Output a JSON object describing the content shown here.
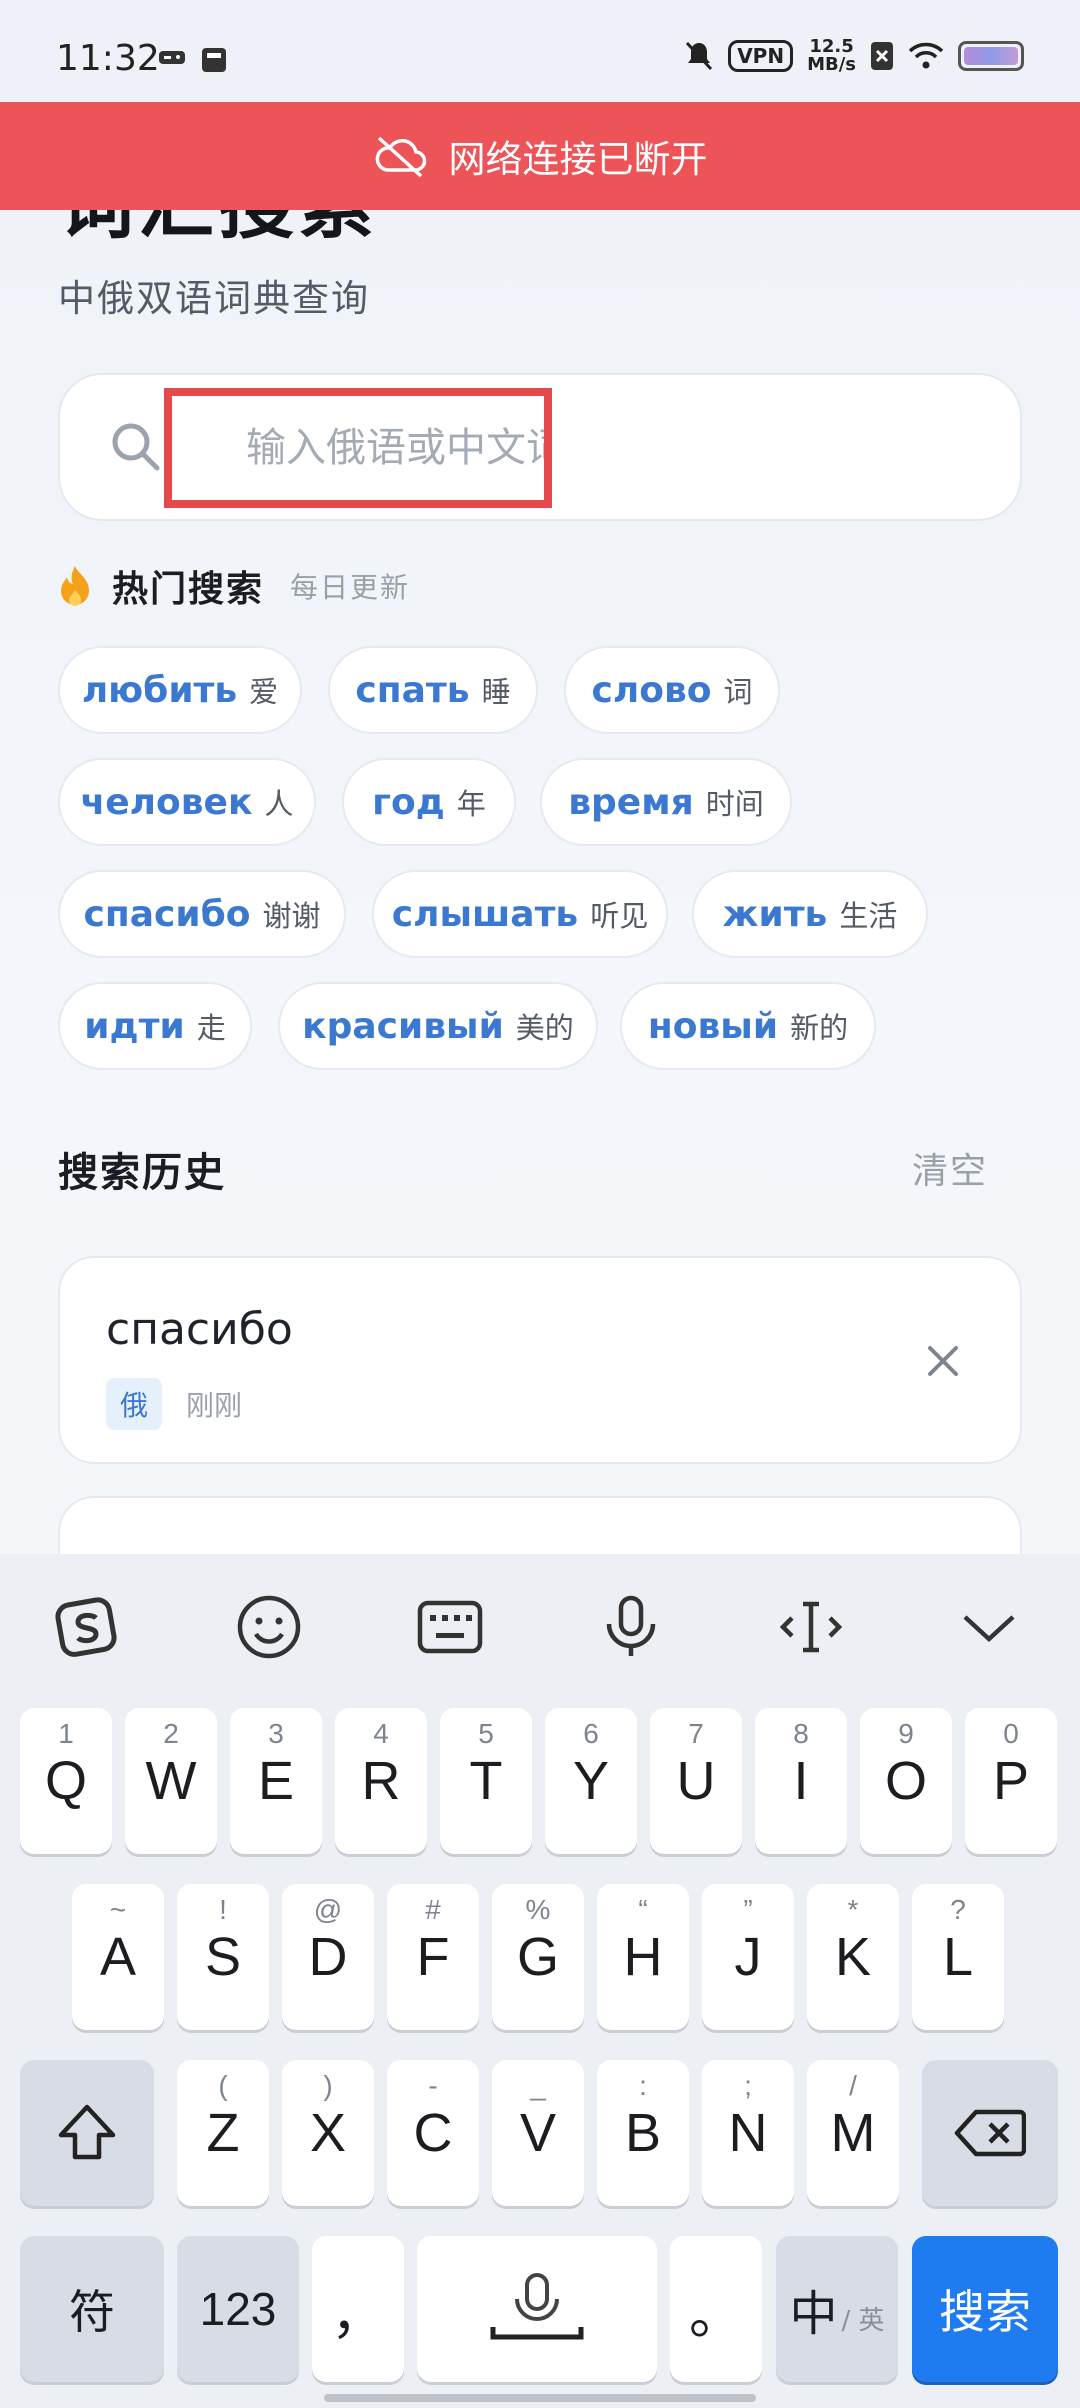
{
  "status_bar": {
    "time": "11:32",
    "vpn": "VPN",
    "speed_value": "12.5",
    "speed_unit": "MB/s"
  },
  "offline_banner": {
    "text": "网络连接已断开",
    "color": "#ec5457"
  },
  "header": {
    "title": "词汇搜索",
    "subtitle": "中俄双语词典查询"
  },
  "search": {
    "placeholder": "输入俄语或中文词汇",
    "value": ""
  },
  "hot": {
    "title": "热门搜索",
    "subtitle": "每日更新",
    "chips": [
      {
        "ru": "любить",
        "zh": "爱"
      },
      {
        "ru": "спать",
        "zh": "睡"
      },
      {
        "ru": "слово",
        "zh": "词"
      },
      {
        "ru": "человек",
        "zh": "人"
      },
      {
        "ru": "год",
        "zh": "年"
      },
      {
        "ru": "время",
        "zh": "时间"
      },
      {
        "ru": "спасибо",
        "zh": "谢谢"
      },
      {
        "ru": "слышать",
        "zh": "听见"
      },
      {
        "ru": "жить",
        "zh": "生活"
      },
      {
        "ru": "идти",
        "zh": "走"
      },
      {
        "ru": "красивый",
        "zh": "美的"
      },
      {
        "ru": "новый",
        "zh": "新的"
      }
    ]
  },
  "history": {
    "title": "搜索历史",
    "clear_label": "清空",
    "items": [
      {
        "word": "спасибо",
        "lang": "俄",
        "time": "刚刚"
      }
    ]
  },
  "keyboard": {
    "row1": [
      {
        "main": "Q",
        "sub": "1"
      },
      {
        "main": "W",
        "sub": "2"
      },
      {
        "main": "E",
        "sub": "3"
      },
      {
        "main": "R",
        "sub": "4"
      },
      {
        "main": "T",
        "sub": "5"
      },
      {
        "main": "Y",
        "sub": "6"
      },
      {
        "main": "U",
        "sub": "7"
      },
      {
        "main": "I",
        "sub": "8"
      },
      {
        "main": "O",
        "sub": "9"
      },
      {
        "main": "P",
        "sub": "0"
      }
    ],
    "row2": [
      {
        "main": "A",
        "sub": "~"
      },
      {
        "main": "S",
        "sub": "!"
      },
      {
        "main": "D",
        "sub": "@"
      },
      {
        "main": "F",
        "sub": "#"
      },
      {
        "main": "G",
        "sub": "%"
      },
      {
        "main": "H",
        "sub": "“"
      },
      {
        "main": "J",
        "sub": "”"
      },
      {
        "main": "K",
        "sub": "*"
      },
      {
        "main": "L",
        "sub": "?"
      }
    ],
    "row3": [
      {
        "main": "Z",
        "sub": "("
      },
      {
        "main": "X",
        "sub": ")"
      },
      {
        "main": "C",
        "sub": "-"
      },
      {
        "main": "V",
        "sub": "_"
      },
      {
        "main": "B",
        "sub": ":"
      },
      {
        "main": "N",
        "sub": ";"
      },
      {
        "main": "M",
        "sub": "/"
      }
    ],
    "symbols_label": "符",
    "numbers_label": "123",
    "comma_label": "，",
    "period_label": "。",
    "lang_label": "中",
    "lang_sub": "/ 英",
    "search_label": "搜索",
    "accent_color": "#1f7bf0"
  }
}
